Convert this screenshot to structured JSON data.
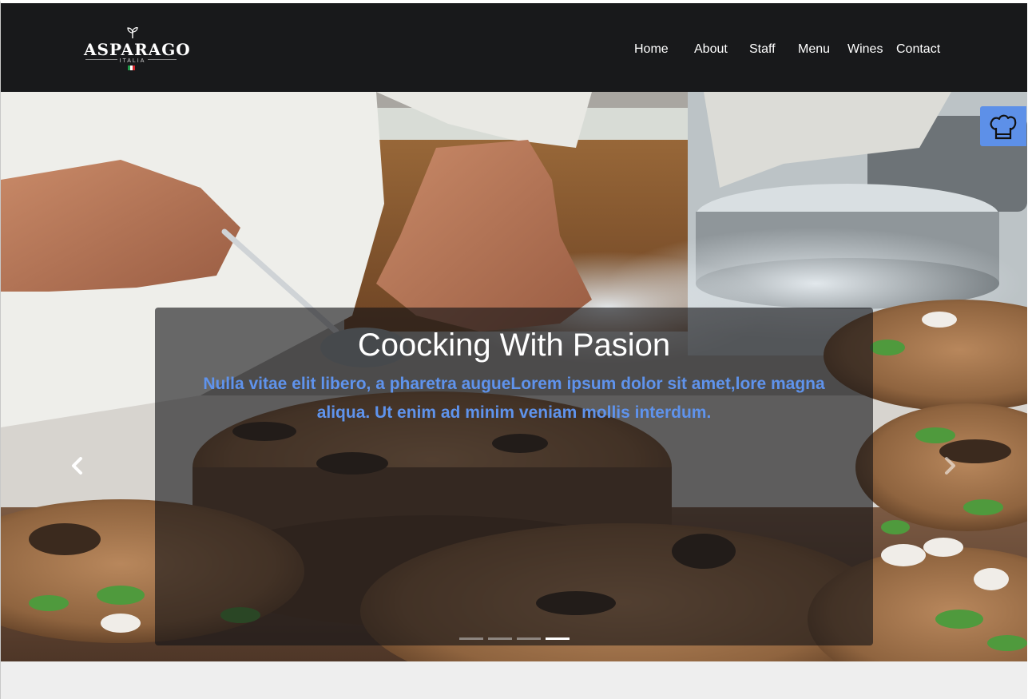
{
  "brand": {
    "name": "ASPARAGO",
    "subtitle": "ITALIA"
  },
  "nav": {
    "items": [
      {
        "label": "Home"
      },
      {
        "label": "About"
      },
      {
        "label": "Staff"
      },
      {
        "label": "Menu"
      },
      {
        "label": "Wines"
      },
      {
        "label": "Contact"
      }
    ]
  },
  "hero": {
    "title": "Coocking With Pasion",
    "text": "Nulla vitae elit libero, a pharetra augueLorem ipsum dolor sit amet,lore magna aliqua. Ut enim ad minim veniam mollis interdum.",
    "slide_count": 4,
    "active_slide": 4
  },
  "icons": {
    "chef_button": "chef-hat-icon",
    "prev": "chevron-left-icon",
    "next": "chevron-right-icon",
    "logo_sprout": "sprout-icon"
  },
  "colors": {
    "navbar_bg": "#18191b",
    "accent_blue": "#5f93ec",
    "chef_button_bg": "#5d90e8",
    "footer_bg": "#eeeeee"
  }
}
